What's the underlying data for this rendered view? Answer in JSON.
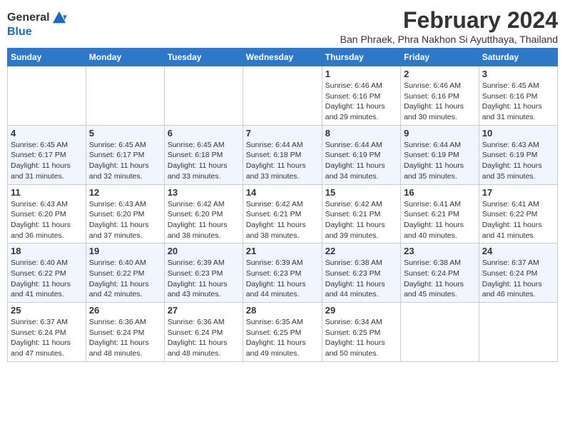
{
  "logo": {
    "general": "General",
    "blue": "Blue"
  },
  "title": "February 2024",
  "subtitle": "Ban Phraek, Phra Nakhon Si Ayutthaya, Thailand",
  "days_of_week": [
    "Sunday",
    "Monday",
    "Tuesday",
    "Wednesday",
    "Thursday",
    "Friday",
    "Saturday"
  ],
  "weeks": [
    [
      {
        "day": "",
        "info": ""
      },
      {
        "day": "",
        "info": ""
      },
      {
        "day": "",
        "info": ""
      },
      {
        "day": "",
        "info": ""
      },
      {
        "day": "1",
        "info": "Sunrise: 6:46 AM\nSunset: 6:16 PM\nDaylight: 11 hours and 29 minutes."
      },
      {
        "day": "2",
        "info": "Sunrise: 6:46 AM\nSunset: 6:16 PM\nDaylight: 11 hours and 30 minutes."
      },
      {
        "day": "3",
        "info": "Sunrise: 6:45 AM\nSunset: 6:16 PM\nDaylight: 11 hours and 31 minutes."
      }
    ],
    [
      {
        "day": "4",
        "info": "Sunrise: 6:45 AM\nSunset: 6:17 PM\nDaylight: 11 hours and 31 minutes."
      },
      {
        "day": "5",
        "info": "Sunrise: 6:45 AM\nSunset: 6:17 PM\nDaylight: 11 hours and 32 minutes."
      },
      {
        "day": "6",
        "info": "Sunrise: 6:45 AM\nSunset: 6:18 PM\nDaylight: 11 hours and 33 minutes."
      },
      {
        "day": "7",
        "info": "Sunrise: 6:44 AM\nSunset: 6:18 PM\nDaylight: 11 hours and 33 minutes."
      },
      {
        "day": "8",
        "info": "Sunrise: 6:44 AM\nSunset: 6:19 PM\nDaylight: 11 hours and 34 minutes."
      },
      {
        "day": "9",
        "info": "Sunrise: 6:44 AM\nSunset: 6:19 PM\nDaylight: 11 hours and 35 minutes."
      },
      {
        "day": "10",
        "info": "Sunrise: 6:43 AM\nSunset: 6:19 PM\nDaylight: 11 hours and 35 minutes."
      }
    ],
    [
      {
        "day": "11",
        "info": "Sunrise: 6:43 AM\nSunset: 6:20 PM\nDaylight: 11 hours and 36 minutes."
      },
      {
        "day": "12",
        "info": "Sunrise: 6:43 AM\nSunset: 6:20 PM\nDaylight: 11 hours and 37 minutes."
      },
      {
        "day": "13",
        "info": "Sunrise: 6:42 AM\nSunset: 6:20 PM\nDaylight: 11 hours and 38 minutes."
      },
      {
        "day": "14",
        "info": "Sunrise: 6:42 AM\nSunset: 6:21 PM\nDaylight: 11 hours and 38 minutes."
      },
      {
        "day": "15",
        "info": "Sunrise: 6:42 AM\nSunset: 6:21 PM\nDaylight: 11 hours and 39 minutes."
      },
      {
        "day": "16",
        "info": "Sunrise: 6:41 AM\nSunset: 6:21 PM\nDaylight: 11 hours and 40 minutes."
      },
      {
        "day": "17",
        "info": "Sunrise: 6:41 AM\nSunset: 6:22 PM\nDaylight: 11 hours and 41 minutes."
      }
    ],
    [
      {
        "day": "18",
        "info": "Sunrise: 6:40 AM\nSunset: 6:22 PM\nDaylight: 11 hours and 41 minutes."
      },
      {
        "day": "19",
        "info": "Sunrise: 6:40 AM\nSunset: 6:22 PM\nDaylight: 11 hours and 42 minutes."
      },
      {
        "day": "20",
        "info": "Sunrise: 6:39 AM\nSunset: 6:23 PM\nDaylight: 11 hours and 43 minutes."
      },
      {
        "day": "21",
        "info": "Sunrise: 6:39 AM\nSunset: 6:23 PM\nDaylight: 11 hours and 44 minutes."
      },
      {
        "day": "22",
        "info": "Sunrise: 6:38 AM\nSunset: 6:23 PM\nDaylight: 11 hours and 44 minutes."
      },
      {
        "day": "23",
        "info": "Sunrise: 6:38 AM\nSunset: 6:24 PM\nDaylight: 11 hours and 45 minutes."
      },
      {
        "day": "24",
        "info": "Sunrise: 6:37 AM\nSunset: 6:24 PM\nDaylight: 11 hours and 46 minutes."
      }
    ],
    [
      {
        "day": "25",
        "info": "Sunrise: 6:37 AM\nSunset: 6:24 PM\nDaylight: 11 hours and 47 minutes."
      },
      {
        "day": "26",
        "info": "Sunrise: 6:36 AM\nSunset: 6:24 PM\nDaylight: 11 hours and 48 minutes."
      },
      {
        "day": "27",
        "info": "Sunrise: 6:36 AM\nSunset: 6:24 PM\nDaylight: 11 hours and 48 minutes."
      },
      {
        "day": "28",
        "info": "Sunrise: 6:35 AM\nSunset: 6:25 PM\nDaylight: 11 hours and 49 minutes."
      },
      {
        "day": "29",
        "info": "Sunrise: 6:34 AM\nSunset: 6:25 PM\nDaylight: 11 hours and 50 minutes."
      },
      {
        "day": "",
        "info": ""
      },
      {
        "day": "",
        "info": ""
      }
    ]
  ]
}
